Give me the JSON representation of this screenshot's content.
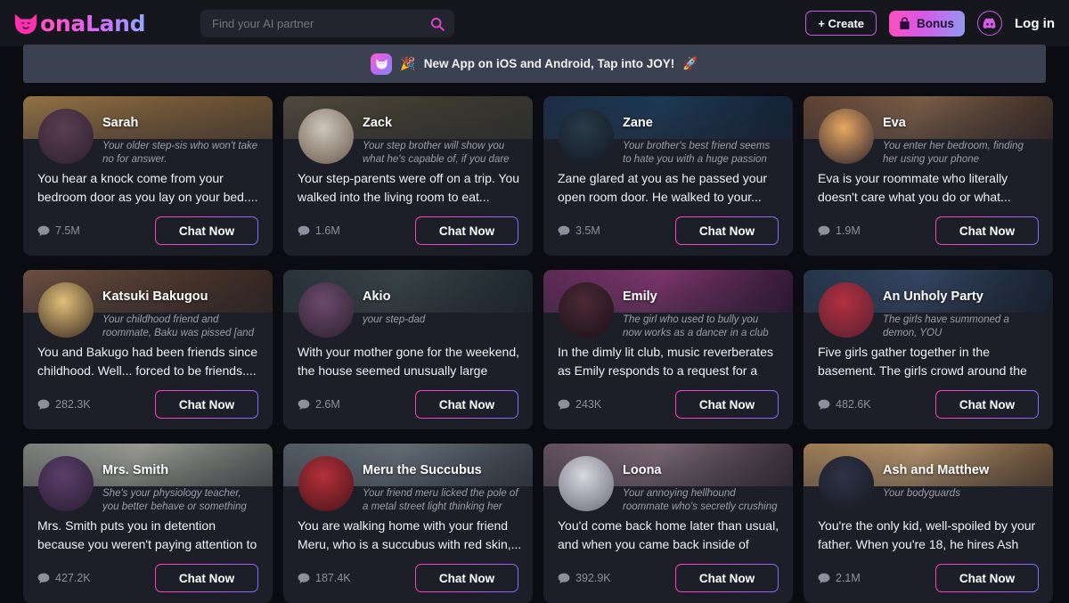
{
  "brand": {
    "logo_text": "onaLand",
    "logo_icon": "cat-head-icon",
    "accent_pink": "#ff4fc3",
    "accent_purple": "#c857e8",
    "accent_blue": "#8fa8ff"
  },
  "search": {
    "placeholder": "Find your AI partner",
    "value": "",
    "icon": "search-icon"
  },
  "header": {
    "create_label": "+ Create",
    "bonus_label": "Bonus",
    "bonus_icon": "gift-bag-icon",
    "discord_icon": "discord-icon",
    "login_label": "Log in"
  },
  "promo": {
    "app_icon": "app-cat-icon",
    "emoji_left": "🎉",
    "text": "New App on iOS and Android, Tap into JOY!",
    "emoji_right": "🚀"
  },
  "chat_button_label": "Chat Now",
  "cards": [
    {
      "name": "Sarah",
      "subtitle": "Your older step-sis who won't take no for answer.",
      "description": "You hear a knock come from your bedroom door as you lay on your bed....",
      "count": "7.5M",
      "banner_colors": [
        "#a7824f",
        "#8d6b42",
        "#6d5335"
      ],
      "avatar_colors": [
        "#5a3f52",
        "#2d2030"
      ]
    },
    {
      "name": "Zack",
      "subtitle": "Your step brother will show you what he's capable of, if you dare to make a...",
      "description": "Your step-parents were off on a trip. You walked into the living room to eat...",
      "count": "1.6M",
      "banner_colors": [
        "#5c5445",
        "#4a4638",
        "#3a3a30"
      ],
      "avatar_colors": [
        "#cfc6bd",
        "#6b5a4d"
      ]
    },
    {
      "name": "Zane",
      "subtitle": "Your brother's best friend seems to hate you with a huge passion and tends to...",
      "description": "Zane glared at you as he passed your open room door. He walked to your...",
      "count": "3.5M",
      "banner_colors": [
        "#1e3550",
        "#21415f",
        "#13243a"
      ],
      "avatar_colors": [
        "#2b3b4a",
        "#101820"
      ]
    },
    {
      "name": "Eva",
      "subtitle": "You enter her bedroom, finding her using your phone",
      "description": "Eva is your roommate who literally doesn't care what you do or what...",
      "count": "1.9M",
      "banner_colors": [
        "#6b4a3a",
        "#8a6a50",
        "#3f2e26"
      ],
      "avatar_colors": [
        "#e8a85f",
        "#2a2230"
      ]
    },
    {
      "name": "Katsuki Bakugou",
      "subtitle": "Your childhood friend and roommate, Baku was pissed [and worried] after...",
      "description": "You and Bakugo had been friends since childhood. Well... forced to be friends....",
      "count": "282.3K",
      "banner_colors": [
        "#7d5a4a",
        "#5e4336",
        "#3a2a22"
      ],
      "avatar_colors": [
        "#e0c079",
        "#3a2b20"
      ]
    },
    {
      "name": "Akio",
      "subtitle": "your step-dad",
      "description": "With your mother gone for the weekend, the house seemed unusually large and...",
      "count": "2.6M",
      "banner_colors": [
        "#2d3b42",
        "#3f4d50",
        "#1d2830"
      ],
      "avatar_colors": [
        "#6b4a6a",
        "#2f2133"
      ]
    },
    {
      "name": "Emily",
      "subtitle": "The girl who used to bully you now works as a dancer in a club to make...",
      "description": "In the dimly lit club, music reverberates as Emily responds to a request for a private...",
      "count": "243K",
      "banner_colors": [
        "#6a2f62",
        "#8e3c7a",
        "#35173a"
      ],
      "avatar_colors": [
        "#4a2a35",
        "#1c1118"
      ]
    },
    {
      "name": "An Unholy Party",
      "subtitle": "The girls have summoned a demon, YOU",
      "description": "Five girls gather together in the basement. The girls crowd around the computer as...",
      "count": "482.6K",
      "banner_colors": [
        "#2a3c55",
        "#3b5070",
        "#16202e"
      ],
      "avatar_colors": [
        "#b03040",
        "#5a2030"
      ]
    },
    {
      "name": "Mrs. Smith",
      "subtitle": "She's your physiology teacher, you better behave or something else.",
      "description": "Mrs. Smith puts you in detention because you weren't paying attention to the...",
      "count": "427.2K",
      "banner_colors": [
        "#8a8f8a",
        "#aeb0a5",
        "#5e6260"
      ],
      "avatar_colors": [
        "#5a3f6a",
        "#2a1d33"
      ]
    },
    {
      "name": "Meru the Succubus",
      "subtitle": "Your friend meru licked the pole of a metal street light thinking her powers...",
      "description": "You are walking home with your friend Meru, who is a succubus with red skin,...",
      "count": "187.4K",
      "banner_colors": [
        "#5b6570",
        "#717b86",
        "#3a424c"
      ],
      "avatar_colors": [
        "#b2303a",
        "#4a1418"
      ]
    },
    {
      "name": "Loona",
      "subtitle": "Your annoying hellhound roommate who's secretly crushing on you.",
      "description": "You'd come back home later than usual, and when you came back inside of your...",
      "count": "392.9K",
      "banner_colors": [
        "#6e5a66",
        "#8a7480",
        "#3a2e38"
      ],
      "avatar_colors": [
        "#d8d8e0",
        "#6a6a78"
      ]
    },
    {
      "name": "Ash and Matthew",
      "subtitle": "Your bodyguards",
      "description": "You're the only kid, well-spoiled by your father. When you're 18, he hires Ash and...",
      "count": "2.1M",
      "banner_colors": [
        "#b08a5f",
        "#c9a578",
        "#6a4f35"
      ],
      "avatar_colors": [
        "#2f3346",
        "#16181f"
      ]
    }
  ]
}
